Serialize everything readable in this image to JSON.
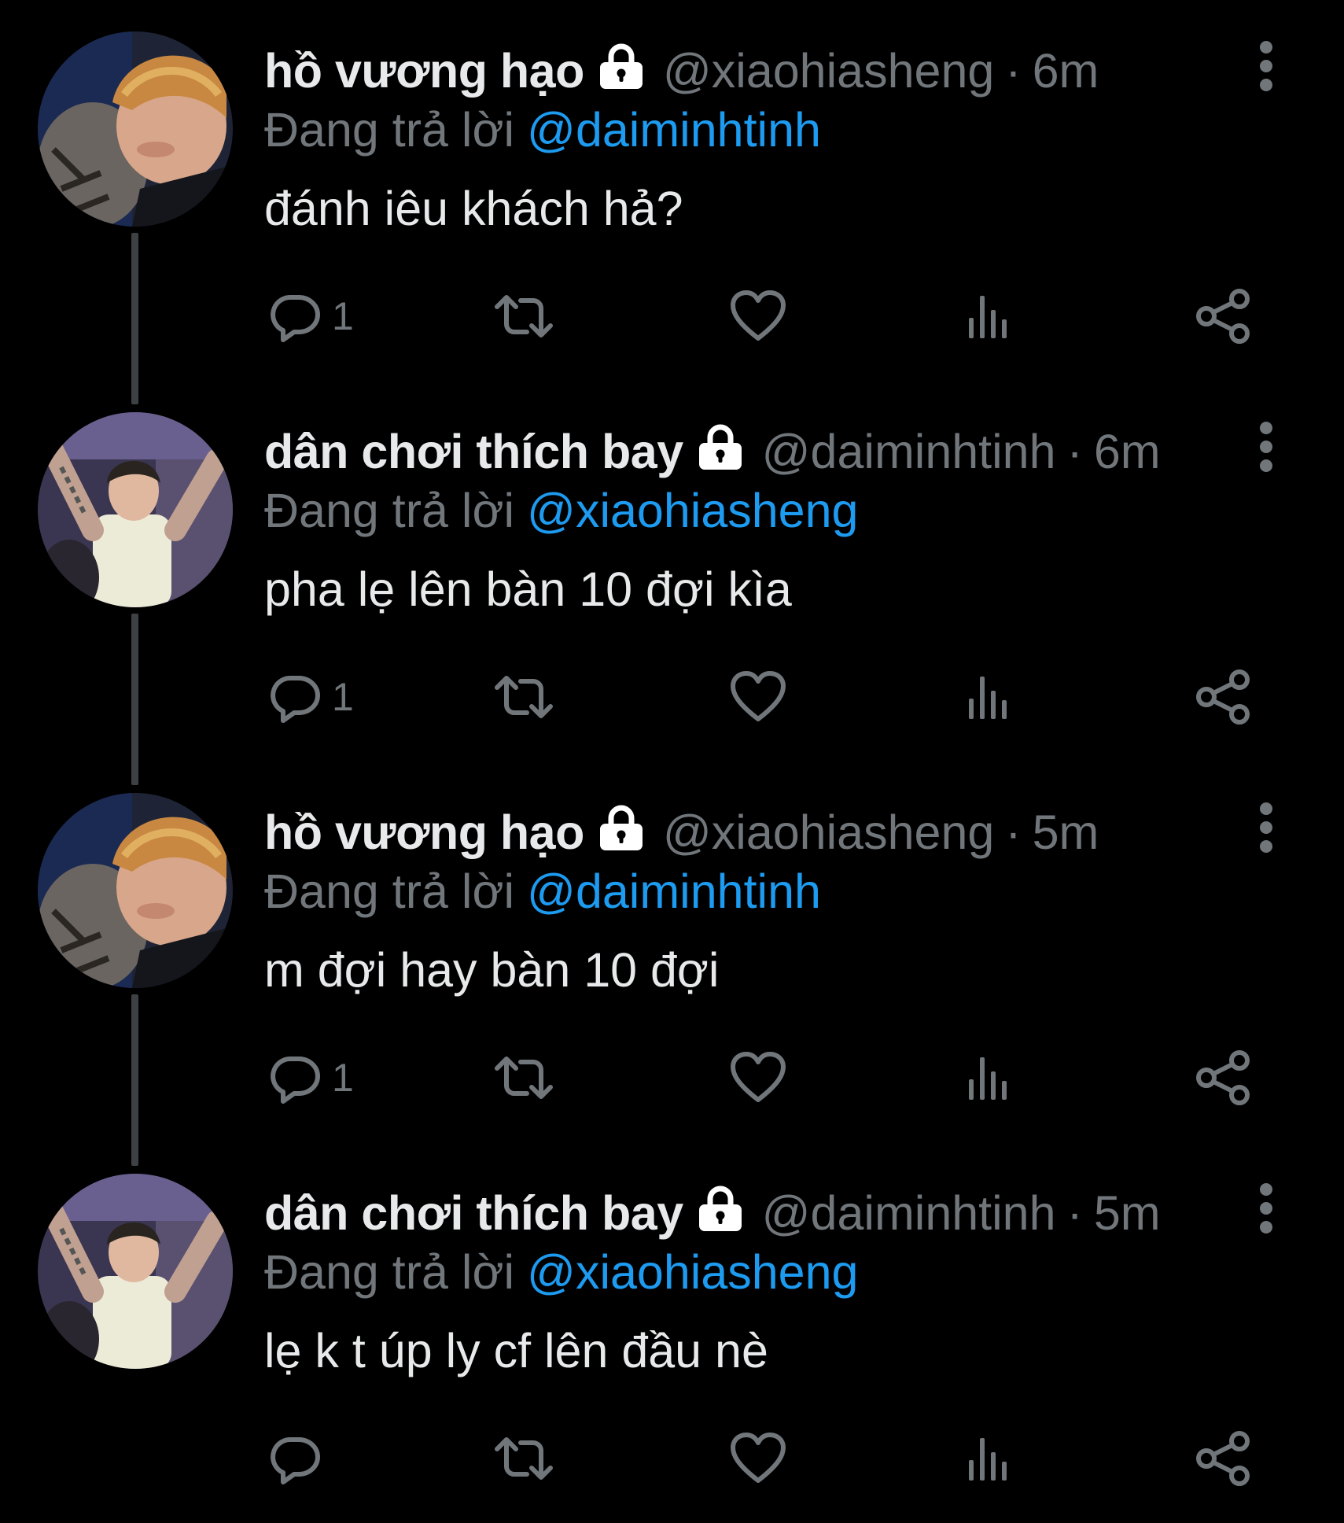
{
  "thread": {
    "tweets": [
      {
        "display_name": "hồ vương hạo",
        "handle": "@xiaohiasheng",
        "separator": "·",
        "time": "6m",
        "reply_prefix": "Đang trả lời",
        "reply_to": "@daiminhtinh",
        "text": "đánh iêu khách hả?",
        "reply_count": "1",
        "avatar_icon": "avatar-photo-blonde-hair"
      },
      {
        "display_name": "dân chơi thích bay",
        "handle": "@daiminhtinh",
        "separator": "·",
        "time": "6m",
        "reply_prefix": "Đang trả lời",
        "reply_to": "@xiaohiasheng",
        "text": "pha lẹ lên bàn 10 đợi kìa",
        "reply_count": "1",
        "avatar_icon": "avatar-photo-club"
      },
      {
        "display_name": "hồ vương hạo",
        "handle": "@xiaohiasheng",
        "separator": "·",
        "time": "5m",
        "reply_prefix": "Đang trả lời",
        "reply_to": "@daiminhtinh",
        "text": "m đợi hay bàn 10 đợi",
        "reply_count": "1",
        "avatar_icon": "avatar-photo-blonde-hair"
      },
      {
        "display_name": "dân chơi thích bay",
        "handle": "@daiminhtinh",
        "separator": "·",
        "time": "5m",
        "reply_prefix": "Đang trả lời",
        "reply_to": "@xiaohiasheng",
        "text": "lẹ k t úp ly cf lên đầu nè",
        "reply_count": "",
        "avatar_icon": "avatar-photo-club"
      }
    ]
  },
  "icons": {
    "lock": "lock-icon",
    "more": "more-vertical-icon",
    "reply": "reply-bubble-icon",
    "retweet": "retweet-icon",
    "like": "heart-icon",
    "views": "views-bar-chart-icon",
    "share": "share-icon"
  },
  "colors": {
    "background": "#000000",
    "primary_text": "#e7e9ea",
    "secondary_text": "#71767b",
    "accent": "#1d9bf0",
    "thread_line": "#3e4144"
  }
}
